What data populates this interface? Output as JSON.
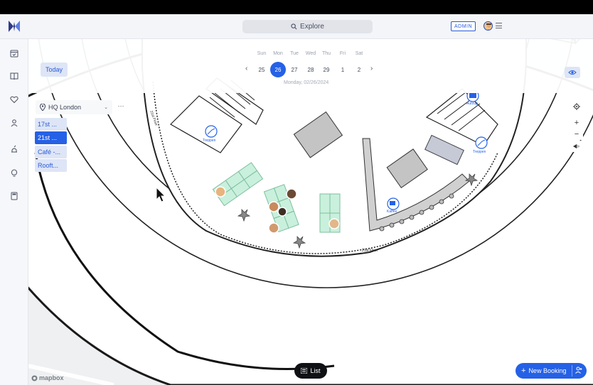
{
  "topbar": {
    "search_label": "Explore",
    "admin_label": "ADMIN"
  },
  "controls": {
    "today_label": "Today"
  },
  "calendar": {
    "day_names": [
      "Sun",
      "Mon",
      "Tue",
      "Wed",
      "Thu",
      "Fri",
      "Sat"
    ],
    "day_numbers": [
      "25",
      "26",
      "27",
      "28",
      "29",
      "1",
      "2"
    ],
    "selected_index": 1,
    "selected_date_label": "Monday, 02/26/2024"
  },
  "location": {
    "name": "HQ London",
    "more_label": "···"
  },
  "floors": [
    "17st ...",
    "21st ...",
    "Café -...",
    "Rooft..."
  ],
  "active_floor_index": 1,
  "map": {
    "labels": {
      "stairs_left": "Treppen",
      "stairs_right": "Treppen",
      "elevator": "Aufzug",
      "coffee": "Kaffee",
      "floor_tag_top": "21st Floor",
      "floor_tag_bottom": "21st Floor"
    },
    "attribution": "mapbox"
  },
  "actions": {
    "list_label": "List",
    "new_booking_label": "New Booking"
  },
  "colors": {
    "accent": "#2561e6",
    "desk": "#c9f0dc",
    "desk_stroke": "#7fbfa1"
  }
}
